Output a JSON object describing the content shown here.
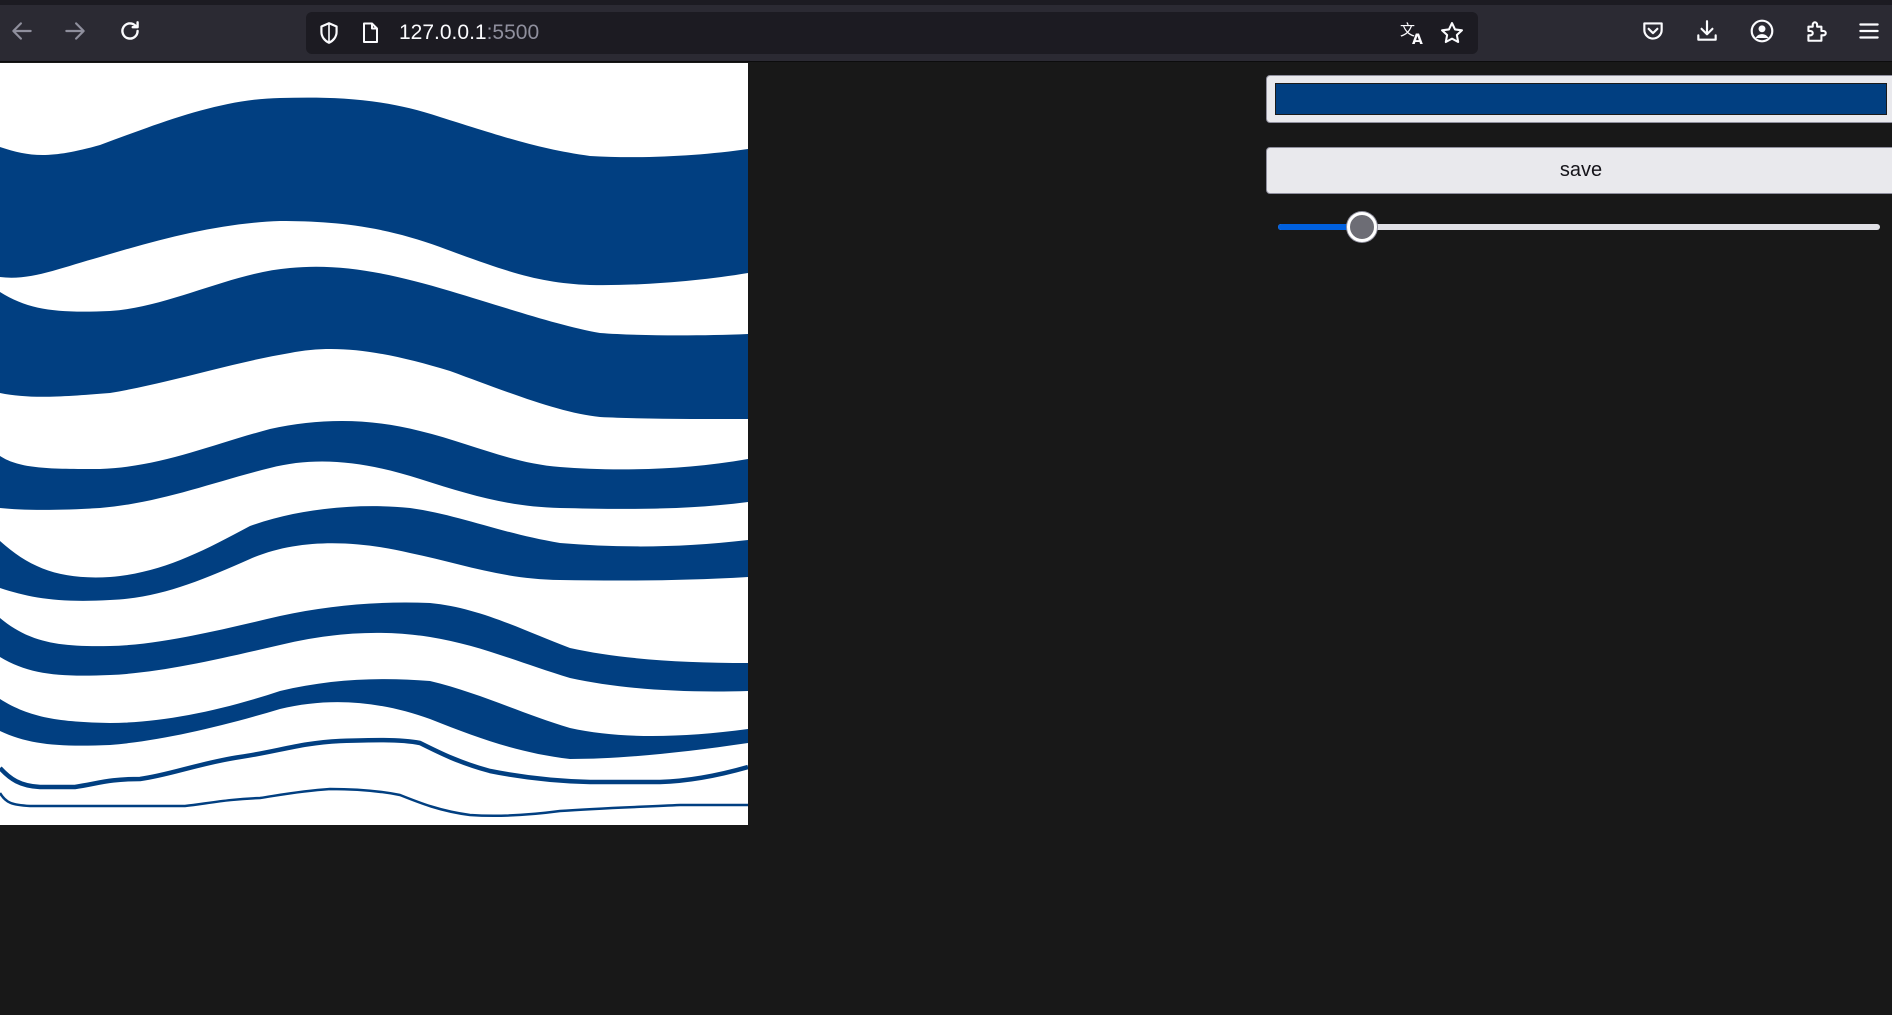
{
  "browser": {
    "url_host": "127.0.0.1",
    "url_port": ":5500",
    "icons": [
      "back-arrow-icon",
      "forward-arrow-icon",
      "reload-icon",
      "shield-icon",
      "page-icon",
      "translate-icon",
      "star-icon",
      "pocket-icon",
      "download-icon",
      "account-icon",
      "extensions-icon",
      "menu-icon"
    ]
  },
  "controls": {
    "color_value": "#013f81",
    "save_label": "save",
    "slider_value": 0.14
  },
  "canvas": {
    "stroke_color": "#013f81",
    "background": "#ffffff"
  }
}
